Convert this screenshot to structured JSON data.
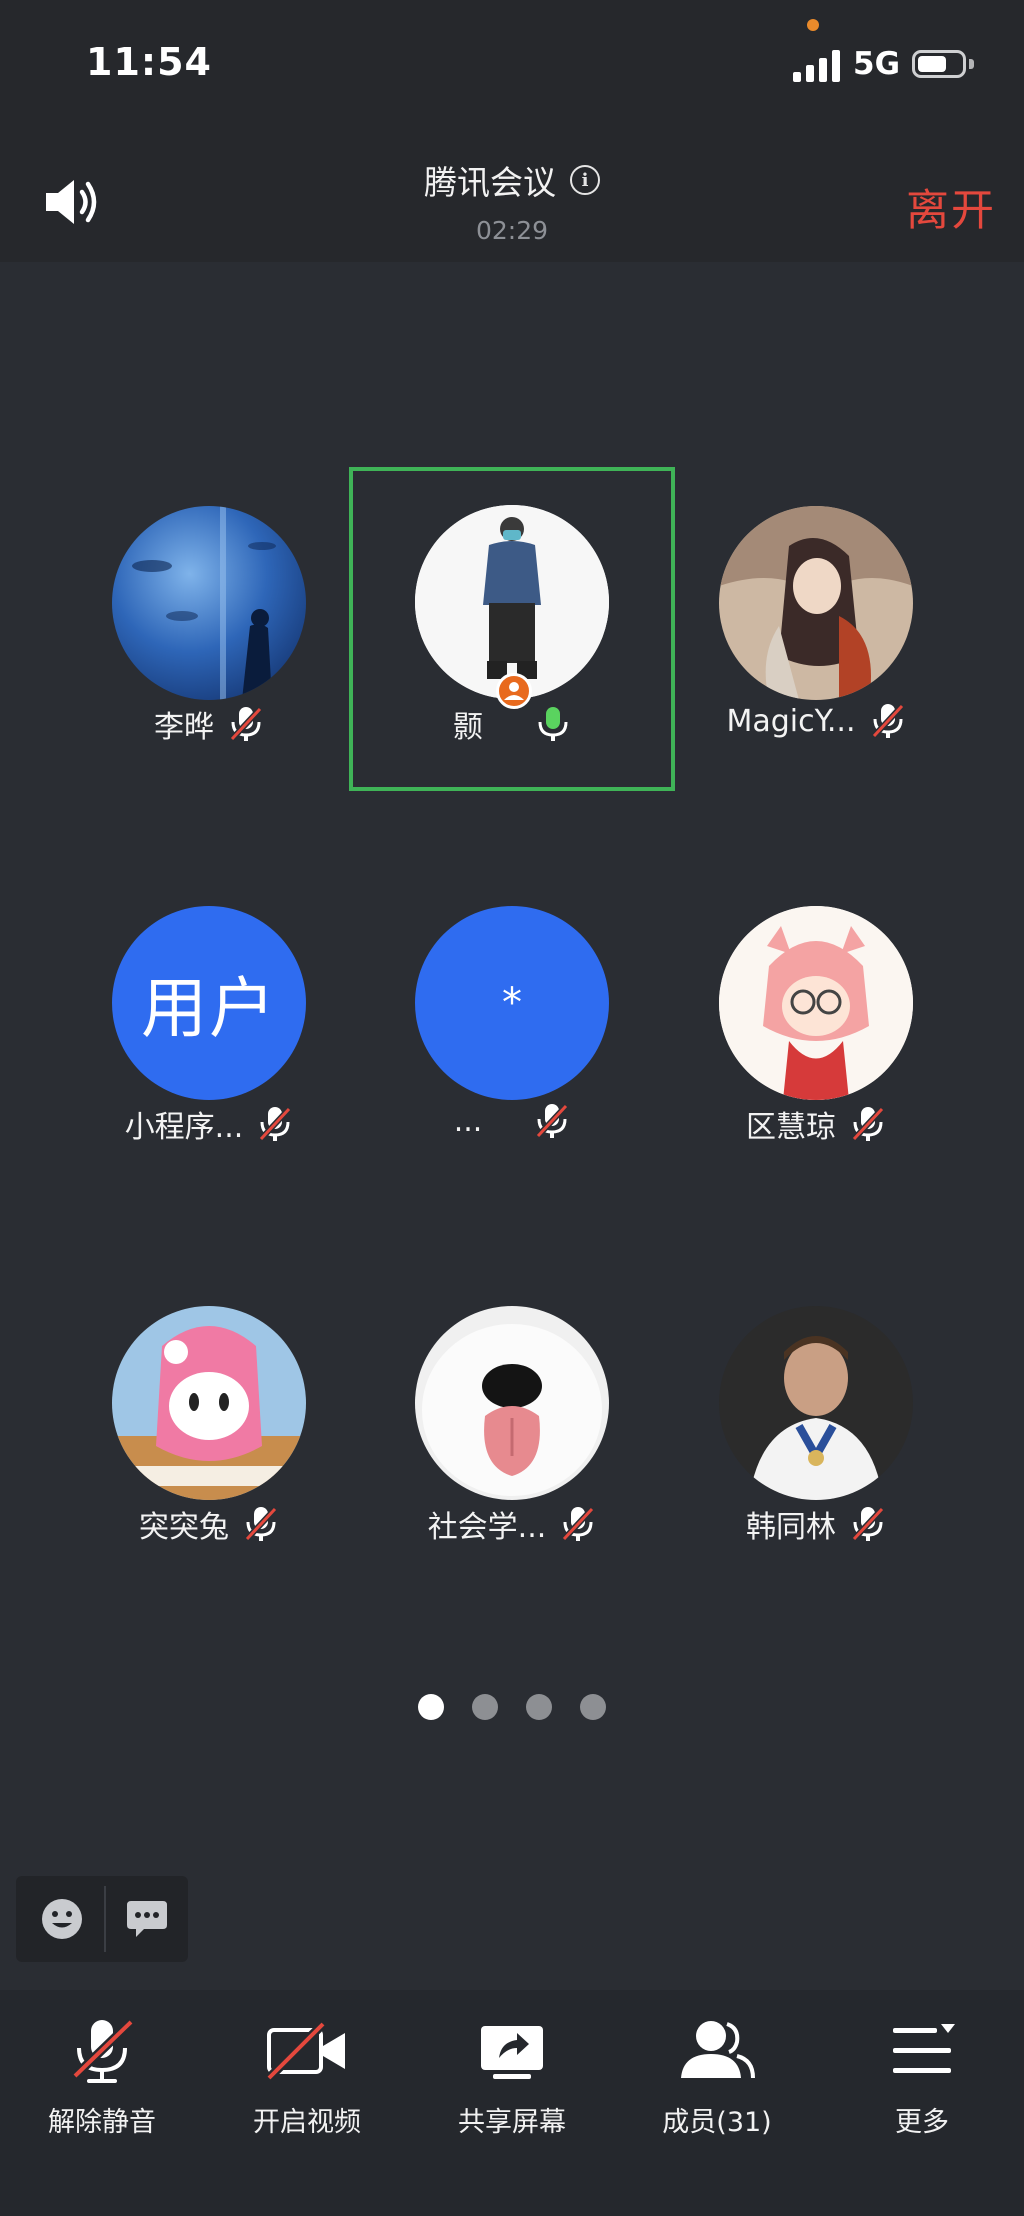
{
  "status_bar": {
    "time": "11:54",
    "network": "5G"
  },
  "header": {
    "title": "腾讯会议",
    "timer": "02:29",
    "leave_label": "离开"
  },
  "participants": [
    {
      "name": "李晔",
      "muted": true
    },
    {
      "name": "颢",
      "muted": false,
      "speaking": true
    },
    {
      "name": "MagicY...",
      "muted": true
    },
    {
      "name": "小程序...",
      "muted": true,
      "avatar_text": "用户"
    },
    {
      "name": "...",
      "muted": true,
      "avatar_text": "*"
    },
    {
      "name": "区慧琼",
      "muted": true
    },
    {
      "name": "突突兔",
      "muted": true
    },
    {
      "name": "社会学...",
      "muted": true
    },
    {
      "name": "韩同林",
      "muted": true
    }
  ],
  "pagination": {
    "pages": 4,
    "current": 1
  },
  "toolbar": {
    "unmute_label": "解除静音",
    "video_label": "开启视频",
    "share_label": "共享屏幕",
    "members_label": "成员(31)",
    "more_label": "更多"
  },
  "colors": {
    "accent_green": "#3fb357",
    "leave_red": "#e4483d",
    "avatar_blue": "#2f6cf0",
    "background": "#2a2d33"
  }
}
